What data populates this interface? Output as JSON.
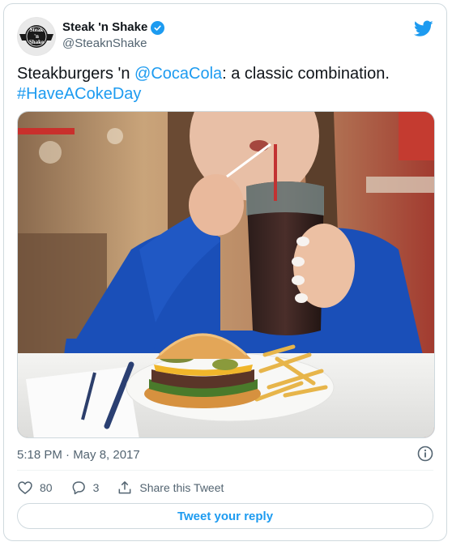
{
  "tweet": {
    "author": {
      "display_name": "Steak 'n Shake",
      "handle": "@SteaknShake",
      "avatar_text": [
        "Steak",
        "'n",
        "Shake"
      ],
      "verified": true
    },
    "text_parts": {
      "prefix": "Steakburgers 'n ",
      "mention": "@CocaCola",
      "middle": ": a classic combination.",
      "hashtag": "#HaveACokeDay"
    },
    "image": {
      "alt": "Woman sipping Coca-Cola through a straw next to a steakburger and fries",
      "icon": "photo"
    },
    "timestamp": "5:18 PM · May 8, 2017",
    "stats": {
      "likes": "80",
      "replies": "3",
      "share_label": "Share this Tweet"
    },
    "reply_button_label": "Tweet your reply"
  },
  "colors": {
    "accent": "#1d9bf0",
    "secondary_text": "#536471",
    "border": "#cfd9de"
  },
  "icons": {
    "brand": "twitter-bird-icon",
    "verified": "verified-badge-icon",
    "info": "info-icon",
    "like": "heart-icon",
    "reply": "speech-bubble-icon",
    "share": "share-upload-icon"
  }
}
